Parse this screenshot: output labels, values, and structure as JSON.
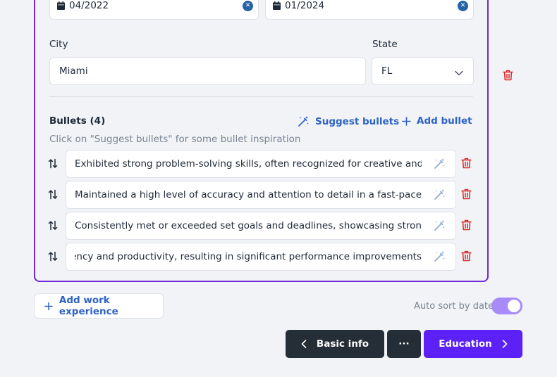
{
  "dates": {
    "start_value": "04/2022",
    "end_value": "01/2024",
    "calendar_icon": "calendar-icon",
    "clear_icon": "clear-icon"
  },
  "location": {
    "city_label": "City",
    "city_value": "Miami",
    "state_label": "State",
    "state_value": "FL"
  },
  "bullets": {
    "title": "Bullets (4)",
    "hint": "Click on \"Suggest bullets\" for some bullet inspiration",
    "suggest_label": "Suggest bullets",
    "add_label": "Add bullet",
    "items": [
      "Exhibited strong problem-solving skills, often recognized for creative and effect",
      "Maintained a high level of accuracy and attention to detail in a fast-paced work e",
      "Consistently met or exceeded set goals and deadlines, showcasing strong perso",
      "e efficiency and productivity, resulting in significant performance improvements"
    ]
  },
  "footer": {
    "add_work_label": "Add work experience",
    "auto_sort_label": "Auto sort by date",
    "auto_sort_on": true,
    "back_label": "Basic info",
    "more_label": "···",
    "next_label": "Education"
  },
  "colors": {
    "accent_purple": "#5b21f6",
    "card_border": "#6d28d9",
    "link_blue": "#2e63c6",
    "delete_red": "#dc2626",
    "dark_button": "#252d37"
  }
}
